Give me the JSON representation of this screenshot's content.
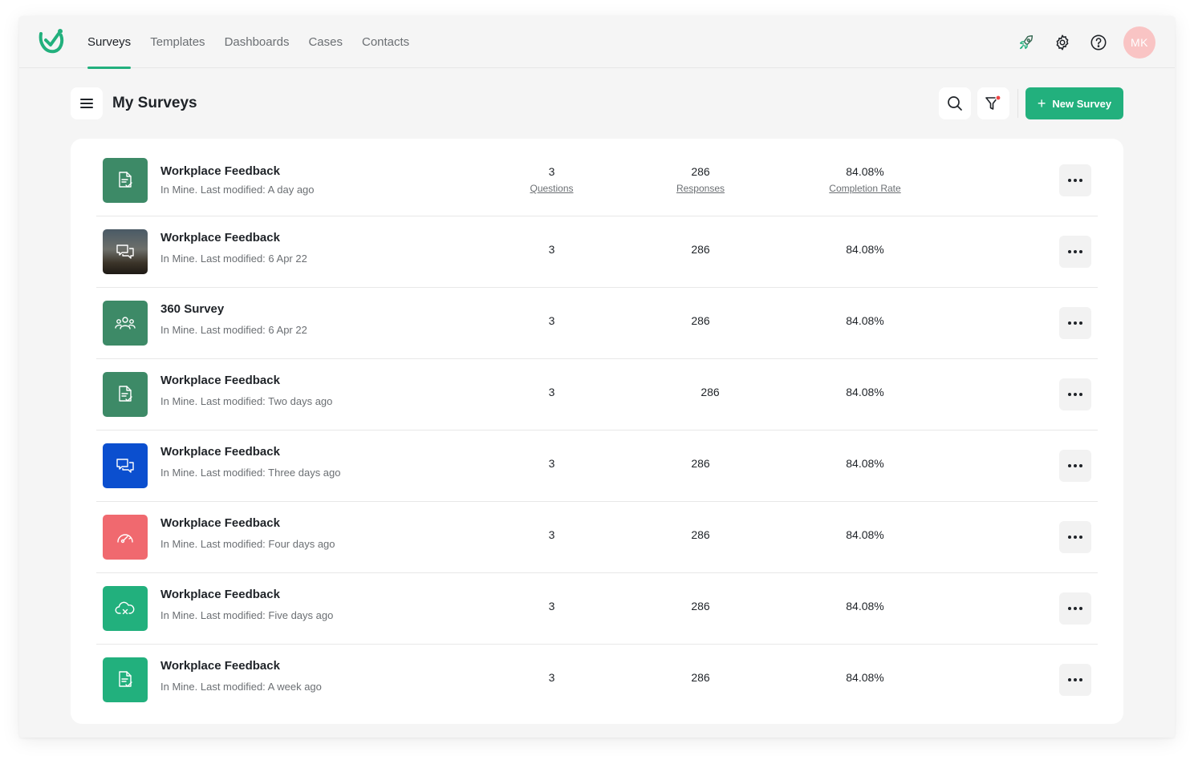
{
  "nav": {
    "items": [
      {
        "label": "Surveys",
        "active": true
      },
      {
        "label": "Templates",
        "active": false
      },
      {
        "label": "Dashboards",
        "active": false
      },
      {
        "label": "Cases",
        "active": false
      },
      {
        "label": "Contacts",
        "active": false
      }
    ],
    "avatar_initials": "MK",
    "icons": [
      "rocket-icon",
      "gear-icon",
      "help-icon"
    ]
  },
  "toolbar": {
    "title": "My Surveys",
    "new_survey_label": "New Survey",
    "icons": [
      "menu-icon",
      "search-icon",
      "filter-icon"
    ]
  },
  "colors": {
    "accent": "#22b07d",
    "thumb_dark_green": "#3d8a67",
    "thumb_blue": "#0b4fcf",
    "thumb_red": "#f0696f",
    "thumb_green": "#22b07d",
    "filter_dot": "#ef4444",
    "avatar": "#f9c4c4"
  },
  "stat_labels": {
    "questions": "Questions",
    "responses": "Responses",
    "completion": "Completion Rate"
  },
  "surveys": [
    {
      "title": "Workplace Feedback",
      "subtitle": "In Mine. Last modified: A day ago",
      "questions": "3",
      "responses": "286",
      "completion": "84.08%",
      "icon": "document-check-icon",
      "color": "#3d8a67"
    },
    {
      "title": "Workplace Feedback",
      "subtitle": "In Mine. Last modified: 6 Apr 22",
      "questions": "3",
      "responses": "286",
      "completion": "84.08%",
      "icon": "chat-bubbles-icon",
      "color": "photo"
    },
    {
      "title": "360 Survey",
      "subtitle": "In Mine. Last modified: 6 Apr 22",
      "questions": "3",
      "responses": "286",
      "completion": "84.08%",
      "icon": "people-group-icon",
      "color": "#3d8a67"
    },
    {
      "title": "Workplace Feedback",
      "subtitle": "In Mine. Last modified: Two days ago",
      "questions": "3",
      "responses": "286",
      "completion": "84.08%",
      "icon": "document-check-icon",
      "color": "#3d8a67"
    },
    {
      "title": "Workplace Feedback",
      "subtitle": "In Mine. Last modified: Three days ago",
      "questions": "3",
      "responses": "286",
      "completion": "84.08%",
      "icon": "chat-bubbles-icon",
      "color": "#0b4fcf"
    },
    {
      "title": "Workplace Feedback",
      "subtitle": "In Mine. Last modified: Four days ago",
      "questions": "3",
      "responses": "286",
      "completion": "84.08%",
      "icon": "gauge-icon",
      "color": "#f0696f"
    },
    {
      "title": "Workplace Feedback",
      "subtitle": "In Mine. Last modified: Five days ago",
      "questions": "3",
      "responses": "286",
      "completion": "84.08%",
      "icon": "cloud-x-icon",
      "color": "#22b07d"
    },
    {
      "title": "Workplace Feedback",
      "subtitle": "In Mine. Last modified: A week ago",
      "questions": "3",
      "responses": "286",
      "completion": "84.08%",
      "icon": "document-check-icon",
      "color": "#22b07d"
    }
  ]
}
